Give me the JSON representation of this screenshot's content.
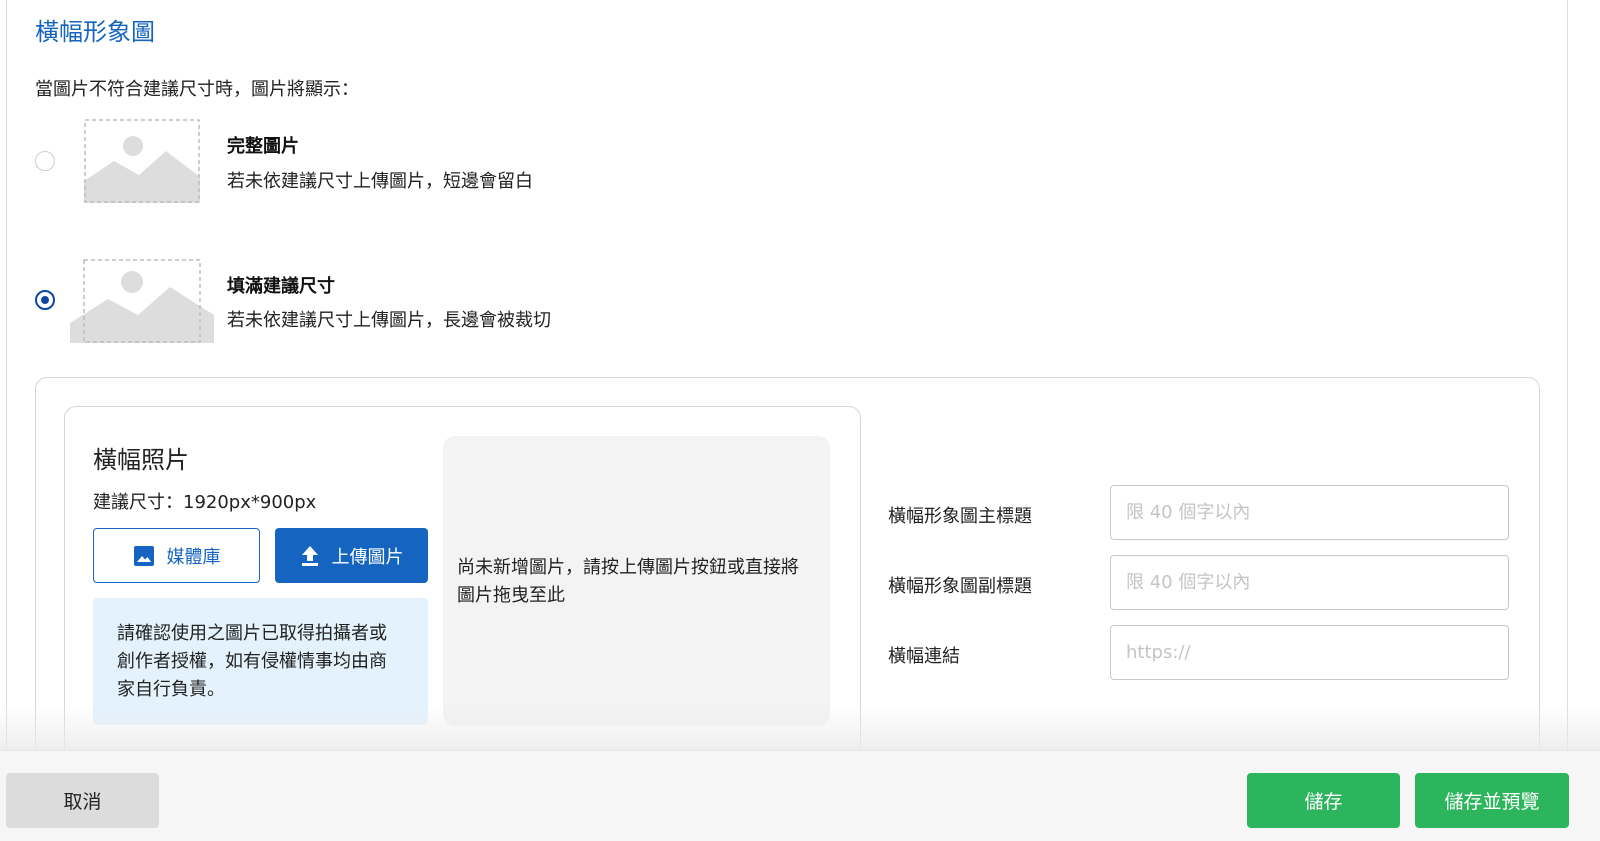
{
  "section": {
    "title": "橫幅形象圖",
    "hint": "當圖片不符合建議尺寸時，圖片將顯示："
  },
  "display_options": [
    {
      "title": "完整圖片",
      "description": "若未依建議尺寸上傳圖片，短邊會留白",
      "selected": false,
      "icon": "image-placeholder-icon"
    },
    {
      "title": "填滿建議尺寸",
      "description": "若未依建議尺寸上傳圖片，長邊會被裁切",
      "selected": true,
      "icon": "image-placeholder-icon"
    }
  ],
  "banner_photo": {
    "title": "橫幅照片",
    "size_hint": "建議尺寸：1920px*900px",
    "media_library_label": "媒體庫",
    "upload_label": "上傳圖片",
    "notice": "請確認使用之圖片已取得拍攝者或創作者授權，如有侵權情事均由商家自行負責。",
    "drop_zone_text": "尚未新增圖片，請按上傳圖片按鈕或直接將圖片拖曳至此"
  },
  "fields": {
    "main_title": {
      "label": "橫幅形象圖主標題",
      "placeholder": "限 40 個字以內",
      "value": ""
    },
    "subtitle": {
      "label": "橫幅形象圖副標題",
      "placeholder": "限 40 個字以內",
      "value": ""
    },
    "link": {
      "label": "橫幅連結",
      "placeholder": "https://",
      "value": ""
    }
  },
  "footer": {
    "cancel_label": "取消",
    "save_label": "儲存",
    "save_preview_label": "儲存並預覽"
  },
  "colors": {
    "accent_blue": "#1565c0",
    "radio_selected": "#0d47a1",
    "save_green": "#2db55d",
    "notice_bg": "#e3f2fc"
  }
}
